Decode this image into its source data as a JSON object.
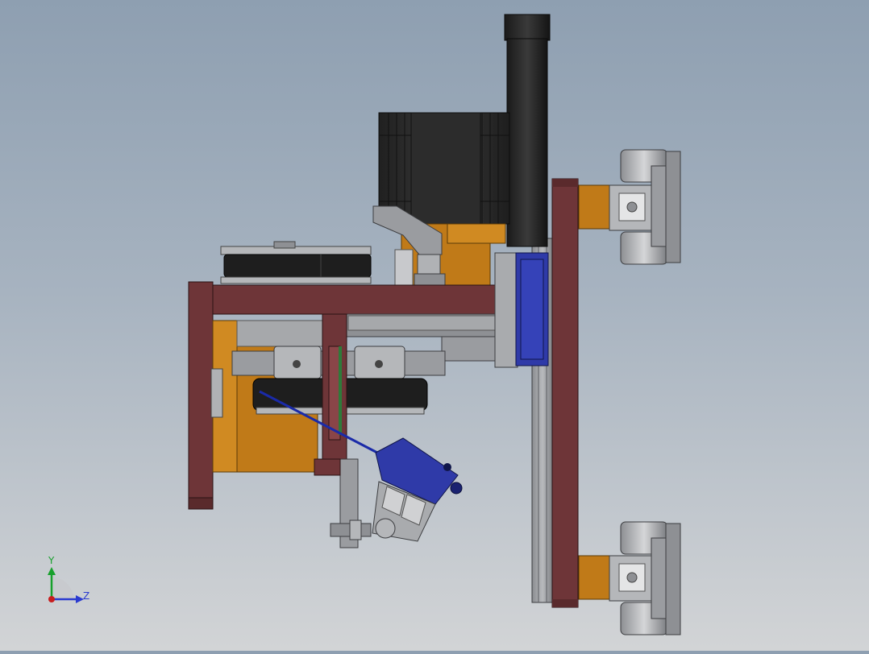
{
  "view": {
    "background_top": "#8e9fb1",
    "background_bottom": "#d2d4d6"
  },
  "triad": {
    "y_label": "Y",
    "z_label": "Z",
    "y_color": "#17a02c",
    "z_color": "#2a3ad0",
    "x_color": "#c81e1e"
  },
  "colors": {
    "frame_maroon": "#6e3538",
    "bracket_orange": "#c07a18",
    "motor_black": "#2a2a2a",
    "steel_gray": "#a9abae",
    "dark_gray": "#6a6c70",
    "actuator_blue": "#2f3aa8",
    "pulley_black": "#1e1e1e"
  }
}
